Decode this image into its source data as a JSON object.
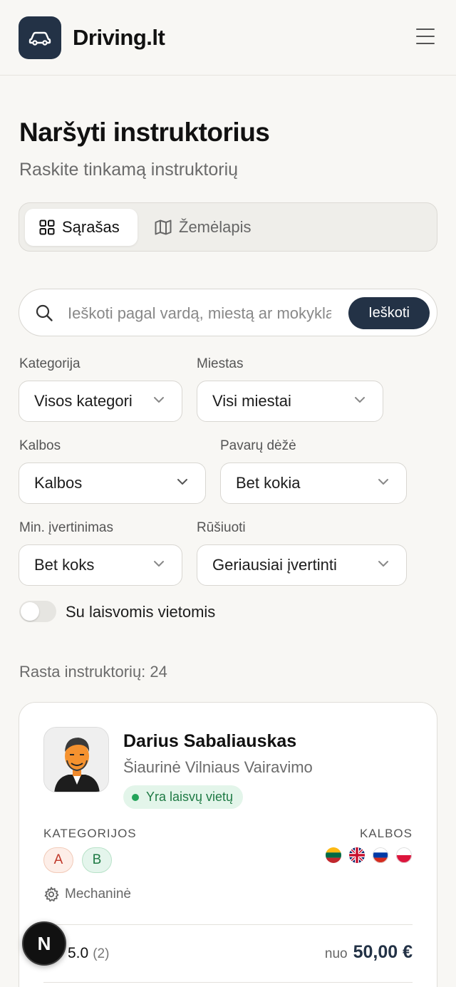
{
  "header": {
    "logo_text": "Driving.lt"
  },
  "page": {
    "title": "Naršyti instruktorius",
    "subtitle": "Raskite tinkamą instruktorių"
  },
  "view_toggle": {
    "list_label": "Sąrašas",
    "map_label": "Žemėlapis",
    "active": "list"
  },
  "search": {
    "placeholder": "Ieškoti pagal vardą, miestą ar mokyklą",
    "button_label": "Ieškoti"
  },
  "filters": {
    "category": {
      "label": "Kategorija",
      "value": "Visos kategorijos"
    },
    "city": {
      "label": "Miestas",
      "value": "Visi miestai"
    },
    "languages": {
      "label": "Kalbos",
      "value": "Kalbos"
    },
    "gearbox": {
      "label": "Pavarų dėžė",
      "value": "Bet kokia"
    },
    "min_rating": {
      "label": "Min. įvertinimas",
      "value": "Bet koks"
    },
    "sort": {
      "label": "Rūšiuoti",
      "value": "Geriausiai įvertinti"
    }
  },
  "available_toggle": {
    "label": "Su laisvomis vietomis",
    "on": false
  },
  "results": {
    "count_text": "Rasta instruktorių: 24"
  },
  "instructor": {
    "name": "Darius Sabaliauskas",
    "school": "Šiaurinė Vilniaus Vairavimo",
    "availability": "Yra laisvų vietų",
    "categories_label": "KATEGORIJOS",
    "categories": [
      "A",
      "B"
    ],
    "languages_label": "KALBOS",
    "languages": [
      "lt-flag-icon",
      "gb-flag-icon",
      "ru-flag-icon",
      "pl-flag-icon"
    ],
    "transmission": "Mechaninė",
    "rating": "5.0",
    "rating_count": "(2)",
    "price_prefix": "nuo",
    "price": "50,00 €"
  },
  "fab": {
    "label": "N"
  },
  "colors": {
    "brand": "#233246",
    "background": "#f8f7f4",
    "success": "#23a35a"
  }
}
